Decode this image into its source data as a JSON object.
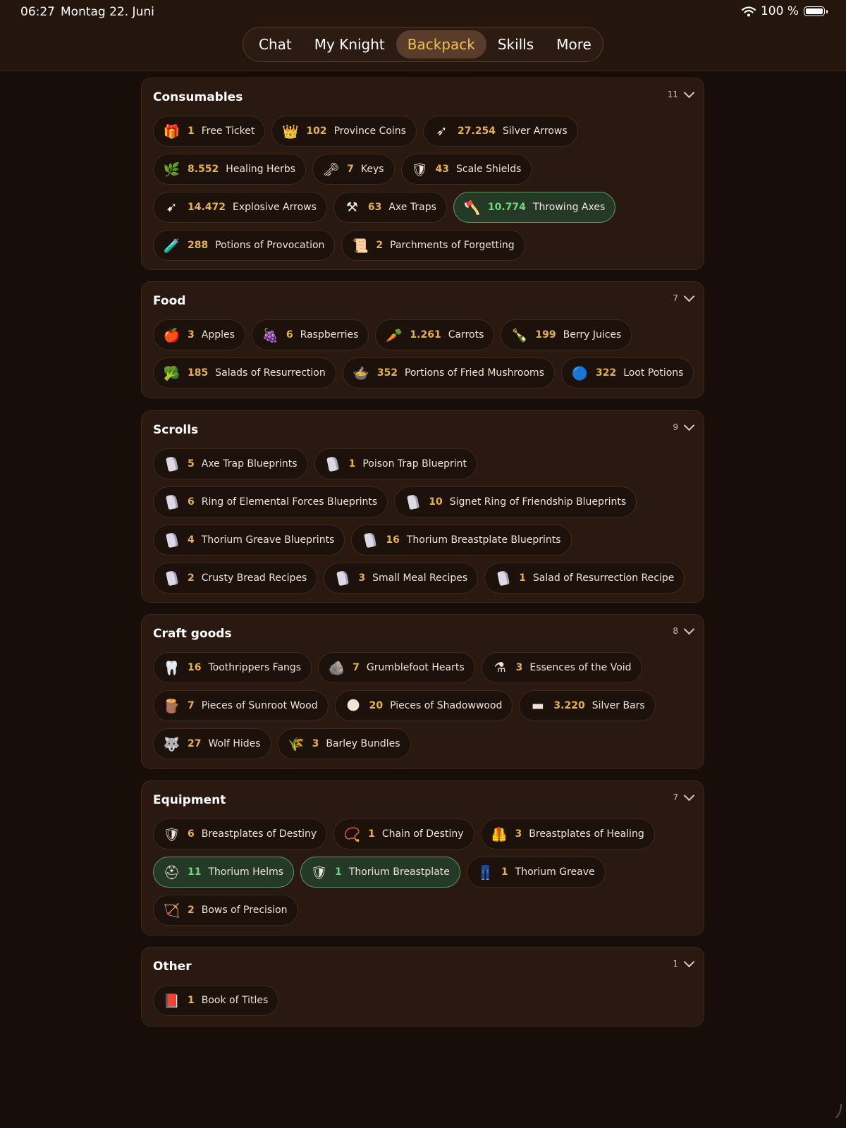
{
  "status": {
    "time": "06:27",
    "date": "Montag 22. Juni",
    "battery": "100 %"
  },
  "nav": {
    "tabs": [
      "Chat",
      "My Knight",
      "Backpack",
      "Skills",
      "More"
    ],
    "active": "Backpack"
  },
  "sections": [
    {
      "title": "Consumables",
      "count": "11",
      "items": [
        {
          "qty": "1",
          "name": "Free Ticket"
        },
        {
          "qty": "102",
          "name": "Province Coins"
        },
        {
          "qty": "27.254",
          "name": "Silver Arrows"
        },
        {
          "qty": "8.552",
          "name": "Healing Herbs"
        },
        {
          "qty": "7",
          "name": "Keys"
        },
        {
          "qty": "43",
          "name": "Scale Shields"
        },
        {
          "qty": "14.472",
          "name": "Explosive Arrows"
        },
        {
          "qty": "63",
          "name": "Axe Traps"
        },
        {
          "qty": "10.774",
          "name": "Throwing Axes"
        },
        {
          "qty": "288",
          "name": "Potions of Provocation"
        },
        {
          "qty": "2",
          "name": "Parchments of Forgetting"
        }
      ]
    },
    {
      "title": "Food",
      "count": "7",
      "items": [
        {
          "qty": "3",
          "name": "Apples"
        },
        {
          "qty": "6",
          "name": "Raspberries"
        },
        {
          "qty": "1.261",
          "name": "Carrots"
        },
        {
          "qty": "199",
          "name": "Berry Juices"
        },
        {
          "qty": "185",
          "name": "Salads of Resurrection"
        },
        {
          "qty": "352",
          "name": "Portions of Fried Mushrooms"
        },
        {
          "qty": "322",
          "name": "Loot Potions"
        }
      ]
    },
    {
      "title": "Scrolls",
      "count": "9",
      "items": [
        {
          "qty": "5",
          "name": "Axe Trap Blueprints"
        },
        {
          "qty": "1",
          "name": "Poison Trap Blueprint"
        },
        {
          "qty": "6",
          "name": "Ring of Elemental Forces Blueprints"
        },
        {
          "qty": "10",
          "name": "Signet Ring of Friendship Blueprints"
        },
        {
          "qty": "4",
          "name": "Thorium Greave Blueprints"
        },
        {
          "qty": "16",
          "name": "Thorium Breastplate Blueprints"
        },
        {
          "qty": "2",
          "name": "Crusty Bread Recipes"
        },
        {
          "qty": "3",
          "name": "Small Meal Recipes"
        },
        {
          "qty": "1",
          "name": "Salad of Resurrection Recipe"
        }
      ]
    },
    {
      "title": "Craft goods",
      "count": "8",
      "items": [
        {
          "qty": "16",
          "name": "Toothrippers Fangs"
        },
        {
          "qty": "7",
          "name": "Grumblefoot Hearts"
        },
        {
          "qty": "3",
          "name": "Essences of the Void"
        },
        {
          "qty": "7",
          "name": "Pieces of Sunroot Wood"
        },
        {
          "qty": "20",
          "name": "Pieces of Shadowwood"
        },
        {
          "qty": "3.220",
          "name": "Silver Bars"
        },
        {
          "qty": "27",
          "name": "Wolf Hides"
        },
        {
          "qty": "3",
          "name": "Barley Bundles"
        }
      ]
    },
    {
      "title": "Equipment",
      "count": "7",
      "items": [
        {
          "qty": "6",
          "name": "Breastplates of Destiny"
        },
        {
          "qty": "1",
          "name": "Chain of Destiny"
        },
        {
          "qty": "3",
          "name": "Breastplates of Healing"
        },
        {
          "qty": "11",
          "name": "Thorium Helms"
        },
        {
          "qty": "1",
          "name": "Thorium Breastplate"
        },
        {
          "qty": "1",
          "name": "Thorium Greave"
        },
        {
          "qty": "2",
          "name": "Bows of Precision"
        }
      ]
    },
    {
      "title": "Other",
      "count": "1",
      "items": [
        {
          "qty": "1",
          "name": "Book of Titles"
        }
      ]
    }
  ],
  "selected_items": [
    "Throwing Axes",
    "Thorium Helms",
    "Thorium Breastplate"
  ],
  "colors": {
    "background": "#170e09",
    "panel": "#2a1911",
    "chip": "#1d110b",
    "quantity": "#e5b14c",
    "selected_quantity": "#73d47a",
    "active_tab": "#f0c04e"
  }
}
